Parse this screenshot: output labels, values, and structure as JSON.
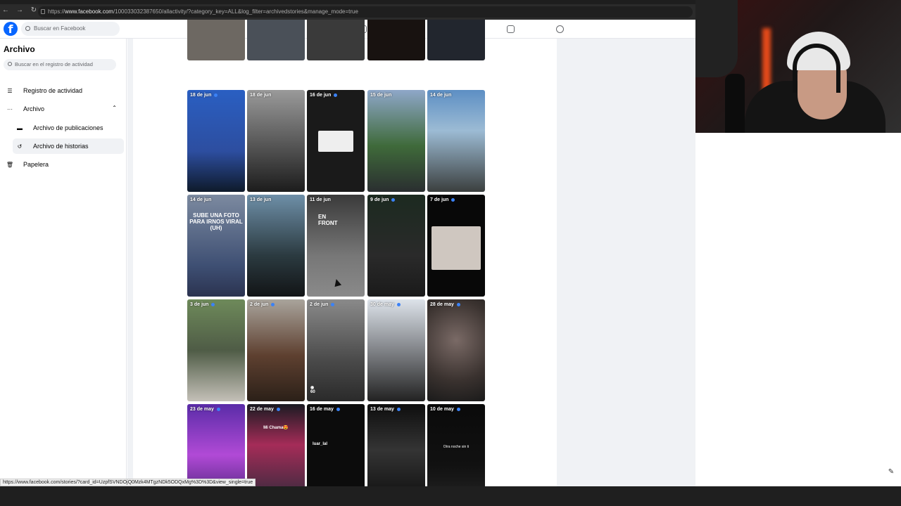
{
  "browser": {
    "url_prefix": "https://",
    "url_domain": "www.facebook.com",
    "url_rest": "/100033032387650/allactivity/?category_key=ALL&log_filter=archivedstories&manage_mode=true"
  },
  "header": {
    "search_placeholder": "Buscar en Facebook"
  },
  "sidebar": {
    "title": "Archivo",
    "search_placeholder": "Buscar en el registro de actividad",
    "items": [
      {
        "label": "Registro de actividad"
      },
      {
        "label": "Archivo"
      },
      {
        "label": "Archivo de publicaciones"
      },
      {
        "label": "Archivo de historias"
      },
      {
        "label": "Papelera"
      }
    ]
  },
  "stories": [
    {
      "date": "18 de jun"
    },
    {
      "date": "18 de jun"
    },
    {
      "date": "16 de jun"
    },
    {
      "date": "15 de jun"
    },
    {
      "date": "14 de jun"
    },
    {
      "date": "14 de jun",
      "text": "SUBE UNA FOTO PARA IRNOS VIRAL (UH)"
    },
    {
      "date": "13 de jun"
    },
    {
      "date": "11 de jun",
      "text": "EN FRONT"
    },
    {
      "date": "9 de jun"
    },
    {
      "date": "7 de jun"
    },
    {
      "date": "3 de jun"
    },
    {
      "date": "2 de jun"
    },
    {
      "date": "2 de jun",
      "views": "60"
    },
    {
      "date": "30 de may"
    },
    {
      "date": "28 de may"
    },
    {
      "date": "23 de may"
    },
    {
      "date": "22 de may",
      "text": "Mi Chama😍"
    },
    {
      "date": "16 de may",
      "text": "luar_lal"
    },
    {
      "date": "13 de may"
    },
    {
      "date": "10 de may",
      "text": "Otra noche sin ti"
    }
  ],
  "status_url": "https://www.facebook.com/stories/?card_id=UzpfSVNDOjQ0Mzk4MTgzNDk5ODQxMg%3D%3D&view_single=true",
  "colors": {
    "brand": "#0866ff",
    "dot": "#3b82f6"
  }
}
